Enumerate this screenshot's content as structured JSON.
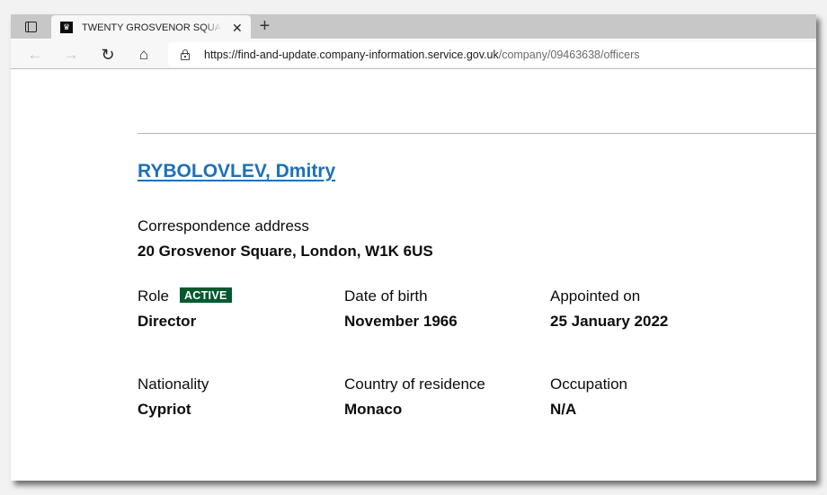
{
  "browser": {
    "tab": {
      "title": "TWENTY GROSVENOR SQUARE MANAGEMENT LIMITED",
      "favicon": "crown-icon",
      "close_glyph": "✕"
    },
    "newtab_glyph": "+",
    "nav": {
      "back_glyph": "←",
      "forward_glyph": "→",
      "reload_glyph": "↻",
      "home_glyph": "⌂"
    },
    "address": {
      "host": "https://find-and-update.company-information.service.gov.uk",
      "path": "/company/09463638/officers"
    }
  },
  "officer": {
    "name": "RYBOLOVLEV, Dmitry",
    "correspondence_address": {
      "label": "Correspondence address",
      "value": "20 Grosvenor Square, London, W1K 6US"
    },
    "role": {
      "label": "Role",
      "status": "ACTIVE",
      "status_color": "#005a30",
      "value": "Director"
    },
    "date_of_birth": {
      "label": "Date of birth",
      "value": "November 1966"
    },
    "appointed_on": {
      "label": "Appointed on",
      "value": "25 January 2022"
    },
    "nationality": {
      "label": "Nationality",
      "value": "Cypriot"
    },
    "country_of_residence": {
      "label": "Country of residence",
      "value": "Monaco"
    },
    "occupation": {
      "label": "Occupation",
      "value": "N/A"
    }
  },
  "colors": {
    "link": "#1d70b8",
    "text": "#0b0c0c",
    "badge_green": "#005a30"
  }
}
